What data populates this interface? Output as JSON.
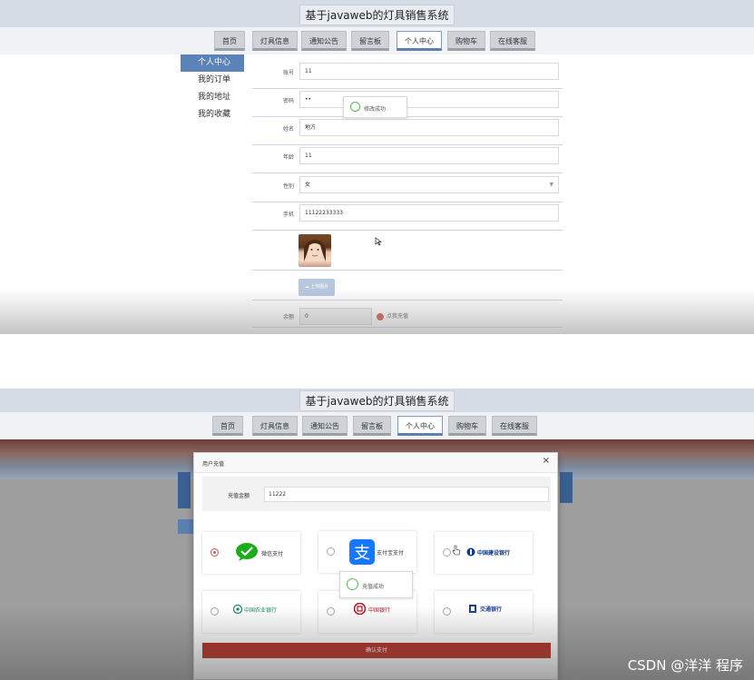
{
  "site_title": "基于javaweb的灯具销售系统",
  "nav": [
    "首页",
    "灯具信息",
    "通知公告",
    "留言板",
    "个人中心",
    "购物车",
    "在线客服"
  ],
  "nav_active": "个人中心",
  "side_menu": [
    "个人中心",
    "我的订单",
    "我的地址",
    "我的收藏"
  ],
  "side_active": "个人中心",
  "profile": {
    "account_label": "账号",
    "account_value": "11",
    "password_label": "密码",
    "password_value": "••",
    "name_label": "姓名",
    "name_value": "地方",
    "age_label": "年龄",
    "age_value": "11",
    "gender_label": "性别",
    "gender_value": "女",
    "phone_label": "手机",
    "phone_value": "11122233333",
    "upload_label": "上传图片",
    "balance_label": "余额",
    "balance_value": "0",
    "recharge_label": "点我充值"
  },
  "toast_modify": "修改成功",
  "modal": {
    "title": "用户充值",
    "close": "×",
    "amount_label": "充值金额",
    "amount_value": "11222",
    "methods": [
      {
        "label": "微信支付",
        "checked": true,
        "icon": "wechat-pay-icon",
        "color": "#1aad19"
      },
      {
        "label": "支付宝支付",
        "checked": false,
        "icon": "alipay-icon",
        "color": "#1677ff"
      },
      {
        "label": "中国建设银行",
        "checked": false,
        "icon": "ccb-logo",
        "color": "#0a3a8c"
      },
      {
        "label": "中国农业银行",
        "checked": false,
        "icon": "abc-logo",
        "color": "#1a8a6a"
      },
      {
        "label": "中国银行",
        "checked": false,
        "icon": "boc-logo",
        "color": "#b40f1e"
      },
      {
        "label": "交通银行",
        "checked": false,
        "icon": "bocom-logo",
        "color": "#1c3f94"
      }
    ],
    "confirm": "确认支付"
  },
  "toast_recharge": "充值成功",
  "watermark": "CSDN @洋洋  程序"
}
